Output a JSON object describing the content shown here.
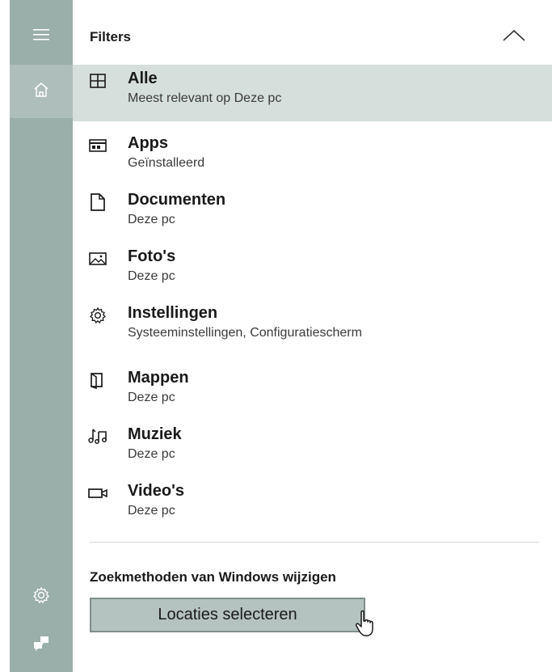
{
  "header": {
    "title": "Filters",
    "collapse_icon": "chevron-up-icon"
  },
  "rail": {
    "items": [
      {
        "icon": "hamburger-menu-icon"
      },
      {
        "icon": "home-icon"
      },
      {
        "icon": "gear-icon"
      },
      {
        "icon": "feedback-icon"
      }
    ]
  },
  "filters": [
    {
      "icon": "grid-icon",
      "title": "Alle",
      "subtitle": "Meest relevant op Deze pc",
      "selected": true
    },
    {
      "icon": "app-window-icon",
      "title": "Apps",
      "subtitle": "Geïnstalleerd"
    },
    {
      "icon": "document-icon",
      "title": "Documenten",
      "subtitle": "Deze pc"
    },
    {
      "icon": "photo-icon",
      "title": "Foto's",
      "subtitle": "Deze pc"
    },
    {
      "icon": "gear-icon",
      "title": "Instellingen",
      "subtitle": "Systeeminstellingen, Configuratiescherm"
    },
    {
      "icon": "folder-icon",
      "title": "Mappen",
      "subtitle": "Deze pc"
    },
    {
      "icon": "music-icon",
      "title": "Muziek",
      "subtitle": "Deze pc"
    },
    {
      "icon": "video-icon",
      "title": "Video's",
      "subtitle": "Deze pc"
    }
  ],
  "footer": {
    "change_label": "Zoekmethoden van Windows wijzigen",
    "button_label": "Locaties selecteren"
  },
  "colors": {
    "rail": "#9aaeaa",
    "selected_row": "#d7dfdd",
    "button": "#b5c3c0"
  }
}
